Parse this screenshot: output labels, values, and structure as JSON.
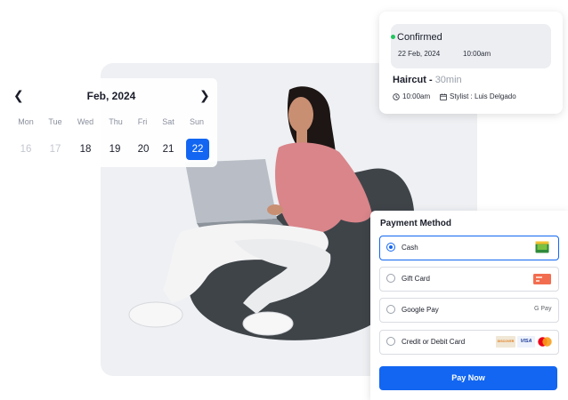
{
  "calendar": {
    "month": "Feb, 2024",
    "day_names": [
      "Mon",
      "Tue",
      "Wed",
      "Thu",
      "Fri",
      "Sat",
      "Sun"
    ],
    "dates": [
      "16",
      "17",
      "18",
      "19",
      "20",
      "21",
      "22"
    ],
    "selected": "22"
  },
  "appointment": {
    "status": "Confirmed",
    "date": "22 Feb, 2024",
    "time": "10:00am",
    "service": "Haircut -",
    "duration": "30min",
    "start_time": "10:00am",
    "stylist": "Stylist : Luis Delgado"
  },
  "payment": {
    "title": "Payment Method",
    "options": [
      {
        "label": "Cash",
        "icon": "cash-icon",
        "selected": true
      },
      {
        "label": "Gift Card",
        "icon": "gift-card-icon",
        "selected": false
      },
      {
        "label": "Google Pay",
        "icon": "google-pay-icon",
        "selected": false
      },
      {
        "label": "Credit or Debit Card",
        "icon": "card-brands-icon",
        "selected": false
      }
    ],
    "google_pay_mark": "G Pay",
    "card_brands": [
      "DISCOVER",
      "VISA"
    ],
    "pay_button": "Pay Now"
  },
  "colors": {
    "accent": "#1266f1",
    "confirmed": "#22c55e",
    "muted": "#9aa0ab"
  }
}
